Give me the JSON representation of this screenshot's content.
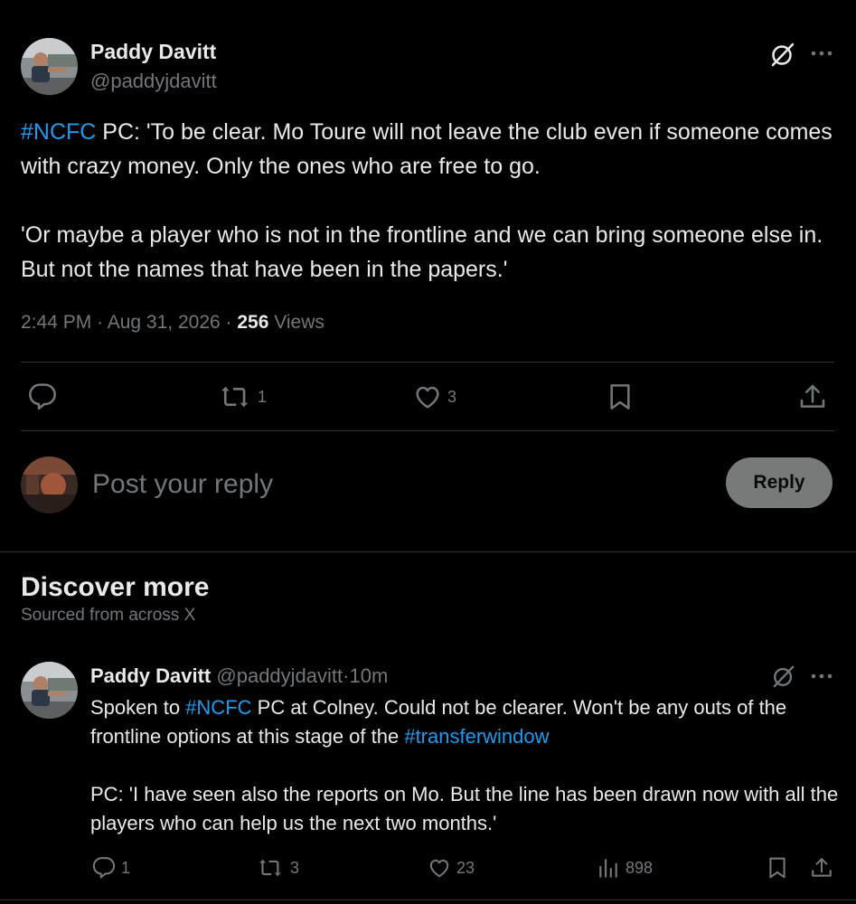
{
  "main_tweet": {
    "author_name": "Paddy Davitt",
    "author_handle": "@paddyjdavitt",
    "hashtag": "#NCFC",
    "paragraph1_rest": " PC: 'To be clear. Mo Toure will not leave the club even if someone comes with crazy money. Only the ones who are free to go.",
    "paragraph2": "'Or maybe a player who is not in the frontline and we can bring someone else in. But not the names that have been in the papers.'",
    "time": "2:44 PM",
    "date": "Aug 31, 2026",
    "views_count": "256",
    "views_label": "Views",
    "actions": {
      "retweets": "1",
      "likes": "3"
    }
  },
  "reply_box": {
    "placeholder": "Post your reply",
    "button_label": "Reply"
  },
  "discover": {
    "title": "Discover more",
    "subtitle": "Sourced from across X"
  },
  "secondary_tweet": {
    "author_name": "Paddy Davitt",
    "author_handle": "@paddyjdavitt",
    "separator": "·",
    "time_ago": "10m",
    "text_part1": "Spoken to ",
    "hashtag1": "#NCFC",
    "text_part2": " PC at Colney. Could not be clearer. Won't be any outs of the frontline options at this stage of the ",
    "hashtag2": "#transferwindow",
    "paragraph2": "PC: 'I have seen also the reports on Mo. But the line has been drawn now with all the players who can help us the next two months.'",
    "actions": {
      "replies": "1",
      "retweets": "3",
      "likes": "23",
      "views": "898"
    }
  },
  "icons": {
    "reply": "reply-icon",
    "retweet": "retweet-icon",
    "like": "heart-icon",
    "bookmark": "bookmark-icon",
    "share": "share-icon",
    "views": "analytics-icon",
    "grok": "grok-icon",
    "more": "more-icon"
  },
  "colors": {
    "background": "#000000",
    "text": "#e7e9ea",
    "muted": "#71767b",
    "link": "#1d9bf0",
    "divider": "#2f3336"
  }
}
